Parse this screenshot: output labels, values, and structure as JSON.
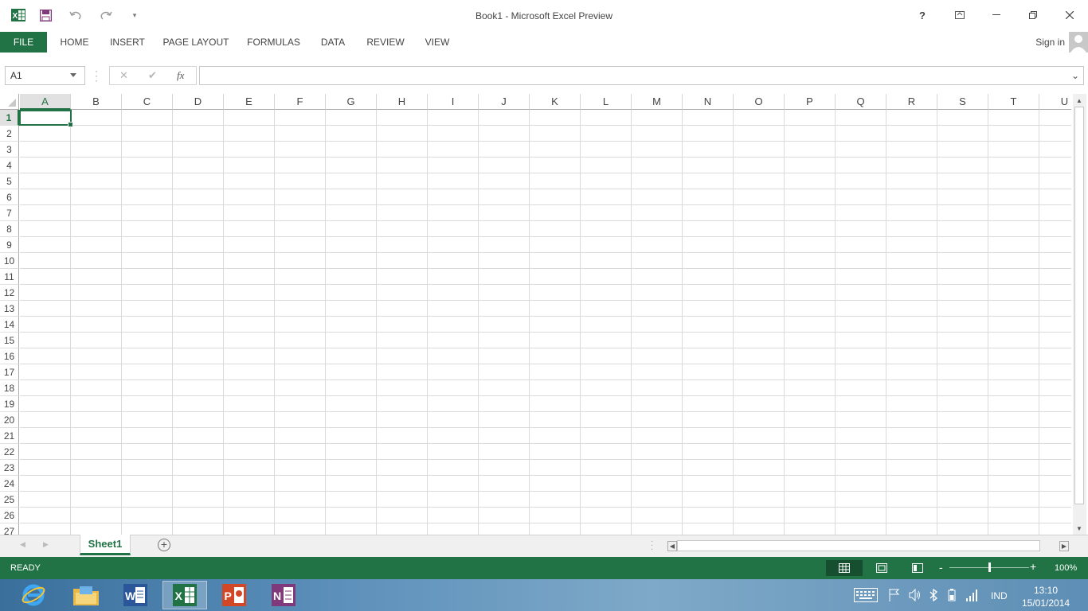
{
  "window": {
    "title": "Book1 - Microsoft Excel Preview",
    "help": "?",
    "sign_in": "Sign in"
  },
  "ribbon_tabs": [
    "FILE",
    "HOME",
    "INSERT",
    "PAGE LAYOUT",
    "FORMULAS",
    "DATA",
    "REVIEW",
    "VIEW"
  ],
  "formula_bar": {
    "name_box": "A1",
    "fx_label": "fx",
    "formula_value": ""
  },
  "grid": {
    "columns": [
      "A",
      "B",
      "C",
      "D",
      "E",
      "F",
      "G",
      "H",
      "I",
      "J",
      "K",
      "L",
      "M",
      "N",
      "O",
      "P",
      "Q",
      "R",
      "S",
      "T",
      "U"
    ],
    "rows": [
      "1",
      "2",
      "3",
      "4",
      "5",
      "6",
      "7",
      "8",
      "9",
      "10",
      "11",
      "12",
      "13",
      "14",
      "15",
      "16",
      "17",
      "18",
      "19",
      "20",
      "21",
      "22",
      "23",
      "24",
      "25",
      "26",
      "27"
    ],
    "selected_cell": "A1"
  },
  "sheets": {
    "tabs": [
      "Sheet1"
    ],
    "active": "Sheet1"
  },
  "status_bar": {
    "mode": "READY",
    "zoom": "100%",
    "zoom_level": 1.0
  },
  "taskbar": {
    "apps": [
      "internet-explorer",
      "file-explorer",
      "word",
      "excel",
      "powerpoint",
      "onenote"
    ],
    "active_app": "excel",
    "language": "IND",
    "time": "13:10",
    "date": "15/01/2014"
  },
  "colors": {
    "accent": "#217346",
    "word": "#2b579a",
    "powerpoint": "#d24726",
    "onenote": "#80397b"
  }
}
